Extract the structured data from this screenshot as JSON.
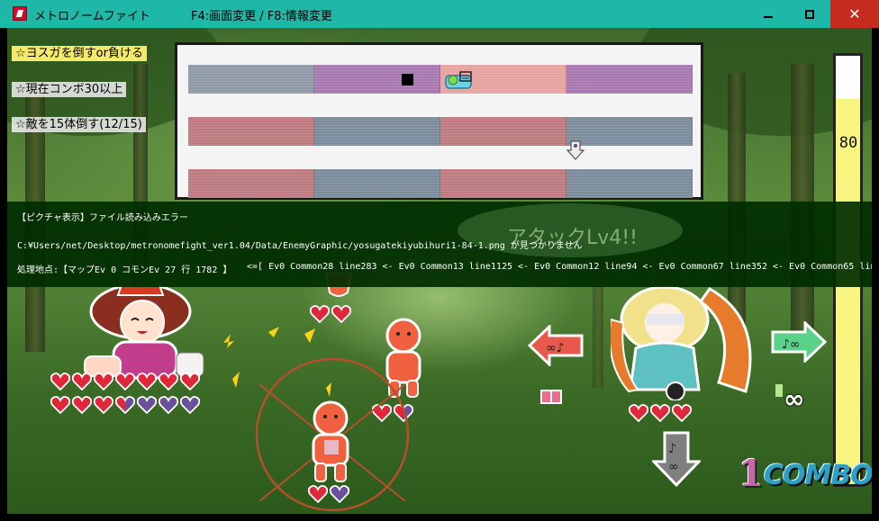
{
  "window": {
    "title": "メトロノームファイト",
    "hint": "F4:画面変更 / F8:情報変更",
    "minimize_label": "–",
    "maximize_label": "□",
    "close_label": "✕"
  },
  "missions": [
    {
      "text": "☆ヨスガを倒すor負ける",
      "active": true
    },
    {
      "text": "☆現在コンボ30以上",
      "active": false
    },
    {
      "text": "☆敵を15体倒す(12/15)",
      "active": false
    }
  ],
  "rhythm_tracks": [
    [
      "gray",
      "purple",
      "salmon",
      "purple"
    ],
    [
      "red",
      "slate",
      "red",
      "slate"
    ],
    [
      "red",
      "slate",
      "red",
      "slate"
    ]
  ],
  "error": {
    "title": "【ピクチャ表示】ファイル読み込みエラー",
    "path": "C:¥Users/net/Desktop/metronomefight_ver1.04/Data/EnemyGraphic/yosugatekiyubihuri1-84-1.png が見つかりません",
    "location": "処理地点:【マップEv 0 コモンEv 27 行 1782 】",
    "trace": "<=[ Ev0 Common28 line283 <- Ev0 Common13 line1125 <- Ev0 Common12 line94 <- Ev0 Common67 line352 <- Ev0 Common65 line58 <- Ev0  line14 ]",
    "behind_text": "アタックLv4!!"
  },
  "gauge": {
    "value": "80",
    "fill_fraction": 0.9
  },
  "combo": {
    "count": "1",
    "label": "COMBO"
  },
  "hearts": {
    "player_row1": [
      "red",
      "red",
      "red",
      "red",
      "red",
      "red",
      "red"
    ],
    "player_row2": [
      "red",
      "red",
      "red",
      "half",
      "purple",
      "purple",
      "purple"
    ],
    "enemy_top": [
      "red",
      "red"
    ],
    "enemy_mid": [
      "red",
      "half"
    ],
    "enemy_bottom": [
      "red",
      "purple"
    ],
    "boss": [
      "red",
      "red",
      "red"
    ]
  },
  "colors": {
    "titlebar": "#1fb7a8",
    "error_bg": "#002d00",
    "gauge_fill": "#f8f580",
    "close": "#c42b1c"
  }
}
